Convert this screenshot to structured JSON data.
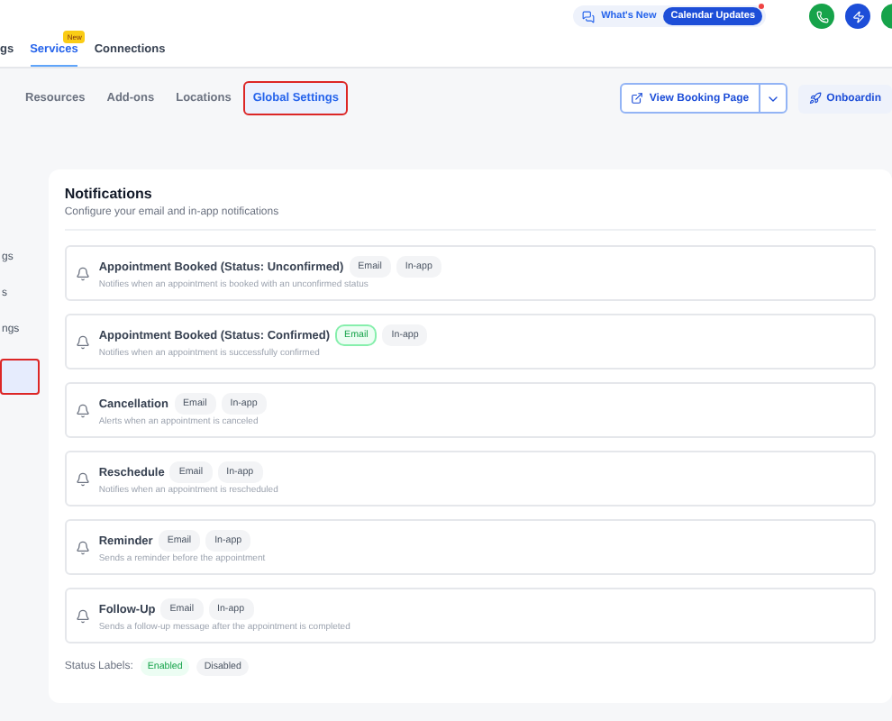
{
  "top_bar": {
    "whats_new": "What's New",
    "updates_pill": "Calendar Updates",
    "updates_unread": true
  },
  "tabs": [
    {
      "label": "gs",
      "selected": false
    },
    {
      "label": "Services",
      "selected": true,
      "badge": "New"
    },
    {
      "label": "Connections",
      "selected": false
    }
  ],
  "sub_tabs": [
    {
      "label": "Resources",
      "selected": false,
      "annotated": false
    },
    {
      "label": "Add-ons",
      "selected": false,
      "annotated": false
    },
    {
      "label": "Locations",
      "selected": false,
      "annotated": false
    },
    {
      "label": "Global Settings",
      "selected": true,
      "annotated": true
    }
  ],
  "actions": {
    "view_booking": "View Booking Page",
    "onboarding": "Onboardin"
  },
  "sidebar": {
    "items": [
      {
        "label": "gs",
        "selected": false,
        "annotated": false
      },
      {
        "label": "s",
        "selected": false,
        "annotated": false
      },
      {
        "label": "ngs",
        "selected": false,
        "annotated": false
      },
      {
        "selected": true,
        "annotated": true
      }
    ]
  },
  "notifications": {
    "title": "Notifications",
    "subtitle": "Configure your email and in-app notifications",
    "items": [
      {
        "title": "Appointment Booked (Status: Unconfirmed)",
        "description": "Notifies when an appointment is booked with an unconfirmed status",
        "channels": [
          {
            "label": "Email",
            "enabled": false
          },
          {
            "label": "In-app",
            "enabled": false
          }
        ]
      },
      {
        "title": "Appointment Booked (Status: Confirmed)",
        "description": "Notifies when an appointment is successfully confirmed",
        "channels": [
          {
            "label": "Email",
            "enabled": true
          },
          {
            "label": "In-app",
            "enabled": false
          }
        ]
      },
      {
        "title": "Cancellation",
        "description": "Alerts when an appointment is canceled",
        "channels": [
          {
            "label": "Email",
            "enabled": false
          },
          {
            "label": "In-app",
            "enabled": false
          }
        ]
      },
      {
        "title": "Reschedule",
        "description": "Notifies when an appointment is rescheduled",
        "channels": [
          {
            "label": "Email",
            "enabled": false
          },
          {
            "label": "In-app",
            "enabled": false
          }
        ]
      },
      {
        "title": "Reminder",
        "description": "Sends a reminder before the appointment",
        "channels": [
          {
            "label": "Email",
            "enabled": false
          },
          {
            "label": "In-app",
            "enabled": false
          }
        ]
      },
      {
        "title": "Follow-Up",
        "description": "Sends a follow-up message after the appointment is completed",
        "channels": [
          {
            "label": "Email",
            "enabled": false
          },
          {
            "label": "In-app",
            "enabled": false
          }
        ]
      }
    ],
    "status_labels": {
      "label": "Status Labels:",
      "items": [
        {
          "label": "Enabled",
          "enabled": true
        },
        {
          "label": "Disabled",
          "enabled": false
        }
      ]
    }
  }
}
